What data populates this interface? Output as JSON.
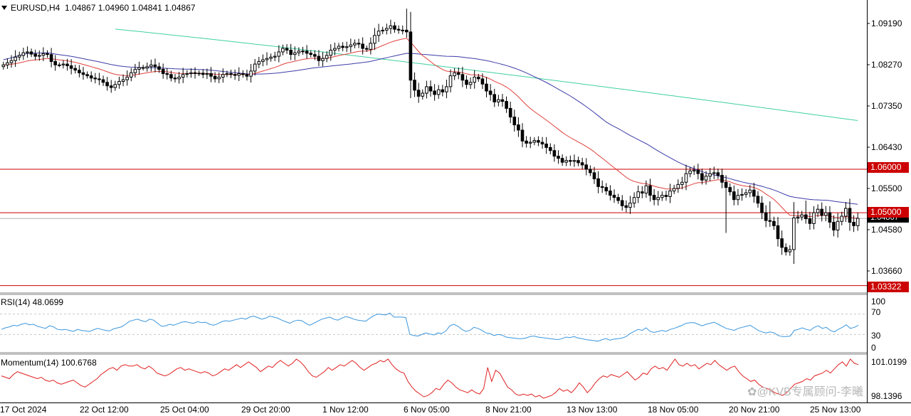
{
  "header": {
    "symbol": "EURUSD,H4",
    "ohlc": "1.04867 1.04960 1.04841 1.04867"
  },
  "price_axis": {
    "ticks": [
      "1.09190",
      "1.08270",
      "1.07350",
      "1.06430",
      "1.05500",
      "1.04580",
      "1.03660"
    ],
    "levels": [
      "1.06000",
      "1.05000",
      "1.03322"
    ],
    "current_price_tag": "1.04867"
  },
  "rsi_panel": {
    "label": "RSI(14) 48.0699",
    "ticks": [
      "100",
      "70",
      "30",
      "0"
    ]
  },
  "momentum_panel": {
    "label": "Momentum(14) 100.6768",
    "ticks": [
      "101.0199",
      "98.1396"
    ]
  },
  "time_axis": {
    "labels": [
      "17 Oct 2024",
      "22 Oct 12:00",
      "25 Oct 04:00",
      "29 Oct 20:00",
      "1 Nov 12:00",
      "6 Nov 05:00",
      "8 Nov 21:00",
      "13 Nov 13:00",
      "18 Nov 05:00",
      "20 Nov 21:00",
      "25 Nov 13:00"
    ]
  },
  "watermark": "@KVB专属顾问-李曦",
  "colors": {
    "bull_candle": "#ffffff",
    "bear_candle": "#000000",
    "ma_fast": "#e0403c",
    "ma_mid": "#3c3ca8",
    "ma_slow": "#40d0a0",
    "level_line": "#cc0000",
    "rsi_line": "#3a96dd",
    "momentum_line": "#e02020"
  },
  "chart_data": [
    {
      "type": "candlestick",
      "title": "EURUSD,H4",
      "ylim": [
        1.0325,
        1.096
      ],
      "x_labels": [
        "17 Oct 2024",
        "22 Oct 12:00",
        "25 Oct 04:00",
        "29 Oct 20:00",
        "1 Nov 12:00",
        "6 Nov 05:00",
        "8 Nov 21:00",
        "13 Nov 13:00",
        "18 Nov 05:00",
        "20 Nov 21:00",
        "25 Nov 13:00"
      ],
      "horizontal_levels": [
        1.06,
        1.05,
        1.03322
      ],
      "current_price": 1.04867,
      "close": [
        1.084,
        1.0845,
        1.085,
        1.0858,
        1.0862,
        1.0868,
        1.087,
        1.0865,
        1.086,
        1.0862,
        1.0866,
        1.0864,
        1.0848,
        1.084,
        1.084,
        1.0842,
        1.0838,
        1.0832,
        1.0828,
        1.0822,
        1.0818,
        1.0815,
        1.081,
        1.0808,
        1.0806,
        1.08,
        1.0792,
        1.0788,
        1.0795,
        1.0802,
        1.0806,
        1.0812,
        1.0822,
        1.083,
        1.0834,
        1.0833,
        1.0836,
        1.084,
        1.0836,
        1.083,
        1.082,
        1.0818,
        1.081,
        1.0808,
        1.0812,
        1.0818,
        1.082,
        1.0822,
        1.082,
        1.0821,
        1.0818,
        1.082,
        1.0814,
        1.0808,
        1.0812,
        1.0818,
        1.082,
        1.0818,
        1.0816,
        1.082,
        1.0818,
        1.0814,
        1.0826,
        1.0842,
        1.0848,
        1.0852,
        1.0855,
        1.0858,
        1.086,
        1.087,
        1.0878,
        1.0874,
        1.0864,
        1.0868,
        1.0872,
        1.0872,
        1.0867,
        1.0864,
        1.086,
        1.085,
        1.0855,
        1.0862,
        1.0874,
        1.0878,
        1.0883,
        1.088,
        1.0882,
        1.0886,
        1.089,
        1.0888,
        1.0878,
        1.0876,
        1.089,
        1.0908,
        1.0918,
        1.092,
        1.0924,
        1.093,
        1.0922,
        1.092,
        1.092,
        1.0916,
        1.0805,
        1.0782,
        1.0768,
        1.0775,
        1.079,
        1.078,
        1.0772,
        1.0783,
        1.0778,
        1.079,
        1.0815,
        1.0822,
        1.0818,
        1.0805,
        1.0795,
        1.08,
        1.0812,
        1.0808,
        1.0796,
        1.078,
        1.0772,
        1.0755,
        1.076,
        1.0756,
        1.074,
        1.072,
        1.0702,
        1.069,
        1.0665,
        1.066,
        1.0662,
        1.0666,
        1.0662,
        1.0658,
        1.065,
        1.0643,
        1.063,
        1.0625,
        1.0616,
        1.062,
        1.0618,
        1.062,
        1.0615,
        1.061,
        1.06,
        1.0592,
        1.0578,
        1.056,
        1.0558,
        1.055,
        1.054,
        1.0535,
        1.0528,
        1.0516,
        1.0512,
        1.0522,
        1.0535,
        1.0548,
        1.0545,
        1.0562,
        1.054,
        1.053,
        1.0535,
        1.054,
        1.0537,
        1.055,
        1.0556,
        1.0565,
        1.057,
        1.059,
        1.0596,
        1.0598,
        1.059,
        1.0575,
        1.0584,
        1.059,
        1.0592,
        1.0586,
        1.057,
        1.0558,
        1.0548,
        1.053,
        1.054,
        1.0542,
        1.0546,
        1.0552,
        1.0538,
        1.0522,
        1.05,
        1.0482,
        1.048,
        1.047,
        1.044,
        1.042,
        1.041,
        1.0415,
        1.0488,
        1.049,
        1.0495,
        1.0486,
        1.0475,
        1.05,
        1.0508,
        1.0494,
        1.05,
        1.0478,
        1.046,
        1.048,
        1.0492,
        1.051,
        1.0478,
        1.047,
        1.0487
      ]
    },
    {
      "type": "line",
      "title": "RSI(14) 48.0699",
      "ylim": [
        0,
        100
      ],
      "reference_lines": [
        70,
        30
      ],
      "y_ticks": [
        100,
        70,
        30,
        0
      ],
      "values": [
        40,
        43,
        45,
        48,
        47,
        50,
        52,
        49,
        50,
        46,
        44,
        42,
        47,
        45,
        40,
        39,
        40,
        38,
        36,
        40,
        38,
        37,
        36,
        39,
        42,
        40,
        38,
        37,
        41,
        43,
        45,
        50,
        56,
        58,
        60,
        57,
        55,
        60,
        58,
        52,
        46,
        47,
        50,
        48,
        51,
        54,
        55,
        53,
        52,
        55,
        53,
        54,
        50,
        48,
        51,
        55,
        57,
        56,
        58,
        60,
        62,
        60,
        64,
        66,
        63,
        60,
        62,
        66,
        64,
        62,
        58,
        55,
        52,
        56,
        58,
        57,
        52,
        48,
        52,
        56,
        60,
        62,
        64,
        60,
        58,
        62,
        65,
        63,
        60,
        58,
        57,
        56,
        62,
        67,
        70,
        69,
        68,
        72,
        64,
        64,
        64,
        63,
        30,
        28,
        27,
        30,
        33,
        31,
        29,
        33,
        32,
        37,
        47,
        50,
        46,
        40,
        36,
        38,
        44,
        42,
        38,
        33,
        32,
        28,
        30,
        29,
        25,
        24,
        23,
        22,
        22,
        23,
        26,
        27,
        25,
        24,
        23,
        22,
        21,
        20,
        22,
        25,
        24,
        26,
        23,
        22,
        20,
        19,
        18,
        17,
        20,
        22,
        19,
        21,
        22,
        23,
        26,
        32,
        36,
        40,
        38,
        43,
        36,
        34,
        36,
        38,
        36,
        40,
        42,
        45,
        48,
        52,
        53,
        53,
        50,
        47,
        50,
        52,
        54,
        50,
        46,
        42,
        40,
        38,
        42,
        44,
        46,
        48,
        43,
        38,
        35,
        33,
        35,
        33,
        28,
        26,
        26,
        27,
        38,
        40,
        43,
        40,
        38,
        44,
        47,
        42,
        44,
        38,
        35,
        40,
        44,
        49,
        42,
        44,
        48
      ]
    },
    {
      "type": "line",
      "title": "Momentum(14) 100.6768",
      "y_ticks": [
        101.0199,
        98.1396
      ],
      "ylim": [
        98.1,
        101.1
      ],
      "values": [
        99.8,
        99.7,
        99.6,
        99.9,
        100.1,
        100.0,
        99.9,
        99.8,
        99.7,
        99.6,
        99.7,
        99.5,
        99.4,
        99.5,
        99.3,
        99.2,
        99.3,
        99.4,
        99.5,
        99.3,
        99.1,
        99.0,
        99.2,
        99.4,
        99.6,
        99.9,
        100.1,
        100.3,
        100.4,
        100.2,
        100.5,
        100.6,
        100.5,
        100.5,
        100.6,
        100.4,
        100.3,
        100.5,
        100.3,
        100.0,
        99.9,
        99.8,
        99.9,
        100.1,
        100.3,
        100.4,
        100.2,
        100.3,
        100.2,
        100.1,
        100.0,
        100.1,
        100.0,
        99.8,
        99.9,
        100.1,
        100.3,
        100.2,
        100.4,
        100.6,
        100.4,
        100.6,
        100.8,
        100.6,
        100.4,
        100.1,
        100.3,
        100.5,
        100.4,
        100.7,
        100.9,
        100.7,
        100.5,
        100.7,
        101.0,
        100.8,
        100.5,
        100.1,
        99.8,
        99.7,
        99.9,
        100.1,
        100.4,
        100.2,
        100.4,
        100.6,
        100.5,
        100.7,
        100.9,
        100.7,
        100.4,
        100.2,
        100.4,
        100.6,
        100.7,
        100.9,
        100.8,
        101.0,
        100.6,
        100.3,
        100.1,
        100.0,
        99.4,
        99.0,
        98.7,
        98.5,
        98.3,
        98.4,
        98.6,
        98.9,
        98.8,
        99.2,
        99.5,
        99.3,
        99.0,
        98.8,
        98.7,
        98.6,
        98.8,
        98.6,
        98.5,
        98.9,
        100.4,
        99.4,
        100.2,
        100.0,
        99.5,
        99.0,
        98.8,
        98.5,
        98.4,
        98.5,
        98.4,
        98.5,
        98.3,
        98.4,
        98.2,
        98.3,
        98.4,
        98.6,
        98.9,
        98.7,
        98.8,
        98.6,
        98.9,
        99.3,
        99.0,
        98.6,
        98.9,
        99.3,
        99.6,
        99.8,
        99.7,
        99.9,
        99.8,
        99.7,
        99.9,
        100.1,
        99.8,
        99.5,
        99.7,
        100.0,
        99.9,
        100.3,
        100.5,
        100.3,
        100.4,
        100.2,
        100.6,
        101.0,
        100.6,
        100.5,
        100.7,
        100.5,
        100.6,
        100.3,
        100.5,
        100.7,
        100.6,
        100.9,
        100.6,
        100.4,
        100.2,
        100.4,
        100.5,
        100.1,
        99.8,
        99.6,
        99.4,
        99.5,
        99.2,
        99.0,
        98.9,
        98.8,
        98.6,
        98.5,
        98.4,
        98.6,
        98.9,
        99.2,
        99.3,
        99.4,
        99.6,
        99.5,
        99.8,
        99.9,
        100.0,
        100.2,
        100.0,
        100.3,
        100.6,
        100.8,
        100.5,
        101.0,
        100.7,
        100.6
      ]
    }
  ]
}
